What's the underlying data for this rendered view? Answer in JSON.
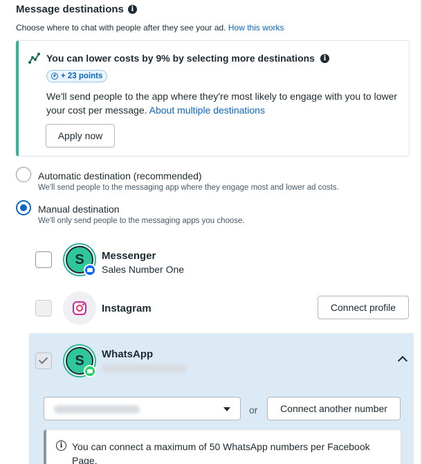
{
  "header": {
    "title": "Message destinations",
    "subtitle": "Choose where to chat with people after they see your ad.",
    "subtitle_link": "How this works"
  },
  "tip": {
    "title": "You can lower costs by 9% by selecting more destinations",
    "badge": "+ 23 points",
    "body": "We'll send people to the app where they're most likely to engage with you to lower your cost per message.",
    "body_link": "About multiple destinations",
    "apply_label": "Apply now"
  },
  "options": {
    "automatic": {
      "label": "Automatic destination (recommended)",
      "desc": "We'll send people to the messaging app where they engage most and lower ad costs.",
      "checked": false
    },
    "manual": {
      "label": "Manual destination",
      "desc": "We'll only send people to the messaging apps you choose.",
      "checked": true
    }
  },
  "destinations": {
    "messenger": {
      "name": "Messenger",
      "account": "Sales Number One",
      "avatar_letter": "S",
      "checked": false
    },
    "instagram": {
      "name": "Instagram",
      "connect_label": "Connect profile",
      "checked": false
    },
    "whatsapp": {
      "name": "WhatsApp",
      "avatar_letter": "S",
      "checked": true,
      "or_label": "or",
      "connect_label": "Connect another number",
      "limit_text": "You can connect a maximum of 50 WhatsApp numbers per Facebook Page."
    }
  },
  "colors": {
    "accent": "#0a66c2",
    "tip_border": "#2fb59a",
    "whatsapp_panel": "#dceaf6",
    "avatar_fill": "#2fc79a"
  },
  "icons": {
    "title_info": "info-icon",
    "tip": "graph-trend-icon",
    "badge": "gauge-icon",
    "collapse": "chevron-up-icon",
    "dropdown": "caret-down-icon",
    "limit_info": "info-outline-icon"
  }
}
